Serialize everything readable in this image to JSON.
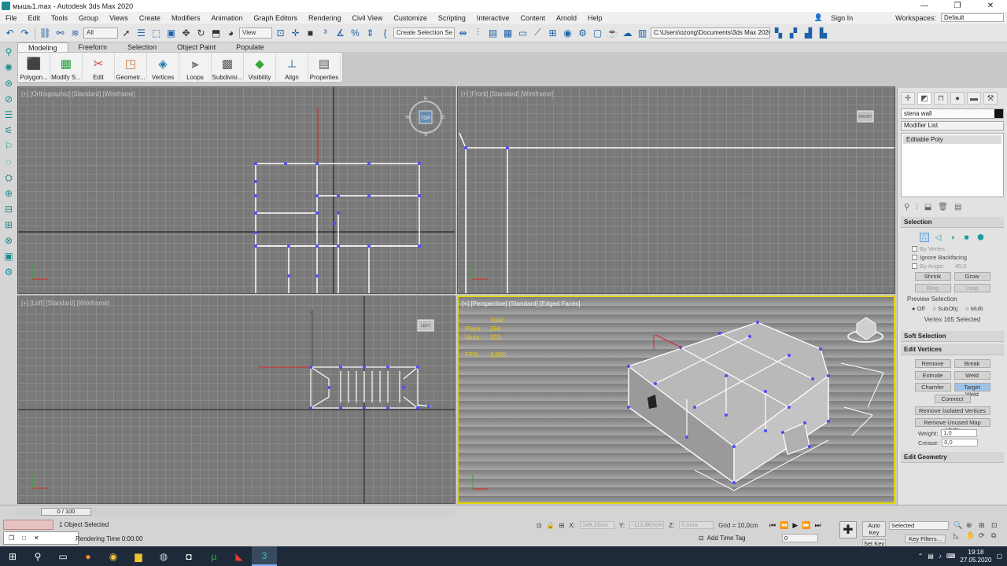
{
  "window": {
    "title": "мышь1.max - Autodesk 3ds Max 2020"
  },
  "menu": [
    "File",
    "Edit",
    "Tools",
    "Group",
    "Views",
    "Create",
    "Modifiers",
    "Animation",
    "Graph Editors",
    "Rendering",
    "Civil View",
    "Customize",
    "Scripting",
    "Interactive",
    "Content",
    "Arnold",
    "Help"
  ],
  "account": {
    "sign_in": "Sign In",
    "workspaces_label": "Workspaces:",
    "workspace": "Default"
  },
  "toolbar": {
    "filter": "All",
    "ref_coord": "View",
    "selection_set": "Create Selection Se",
    "project_path": "C:\\Users\\ozong\\Documents\\3ds Max 2020"
  },
  "ribbon": {
    "tabs": [
      "Modeling",
      "Freeform",
      "Selection",
      "Object Paint",
      "Populate"
    ],
    "buttons": [
      "Polygon...",
      "Modify S...",
      "Edit",
      "Geometr...",
      "Vertices",
      "Loops",
      "Subdivisi...",
      "Visibility",
      "Align",
      "Properties"
    ]
  },
  "viewports": {
    "top": "[+] [Orthographic] [Standard] [Wireframe]",
    "front": "[+] [Front] [Standard] [Wireframe]",
    "left": "[+] [Left] [Standard] [Wireframe]",
    "persp": "[+] [Perspective] [Standard] [Edged Faces]",
    "viewcube_top": "TOP",
    "viewcube_front": "FRONT",
    "viewcube_left": "LEFT",
    "compass": {
      "n": "N",
      "s": "S",
      "w": "W",
      "e": "E"
    },
    "axis": {
      "x": "x",
      "y": "y",
      "z": "z"
    },
    "stats": {
      "total": "Total",
      "polys_label": "Polys:",
      "polys": "264",
      "verts_label": "Verts:",
      "verts": "323",
      "fps_label": "FPS:",
      "fps": "3,880"
    }
  },
  "command_panel": {
    "object_name": "stena wall",
    "modifier_list": "Modifier List",
    "stack_item": "Editable Poly",
    "selection": {
      "title": "Selection",
      "by_vertex": "By Vertex",
      "ignore_backfacing": "Ignore Backfacing",
      "by_angle": "By Angle:",
      "angle_value": "45,0",
      "shrink": "Shrink",
      "grow": "Grow",
      "ring": "Ring",
      "loop": "Loop",
      "preview_selection": "Preview Selection",
      "off": "Off",
      "subobj": "SubObj",
      "multi": "Multi",
      "status": "Vertex 165 Selected"
    },
    "soft_selection": "Soft Selection",
    "edit_vertices": {
      "title": "Edit Vertices",
      "remove": "Remove",
      "break": "Break",
      "extrude": "Extrude",
      "weld": "Weld",
      "chamfer": "Chamfer",
      "target_weld": "Target Weld",
      "connect": "Connect",
      "remove_isolated": "Remove Isolated Vertices",
      "remove_unused": "Remove Unused Map Verts",
      "weight_label": "Weight:",
      "weight": "1,0",
      "crease_label": "Crease:",
      "crease": "0,0"
    },
    "edit_geometry": "Edit Geometry"
  },
  "status": {
    "time_slider": "0 / 100",
    "objects_selected": "1 Object Selected",
    "time": "Rendering Time 0:00:00",
    "x_label": "X:",
    "x": "149,15cm",
    "y_label": "Y:",
    "y": "-112,867cm",
    "z_label": "Z:",
    "z": "0,0cm",
    "grid": "Grid = 10,0cm",
    "add_time_tag": "Add Time Tag",
    "frame": "0",
    "auto_key": "Auto Key",
    "set_key": "Set Key",
    "key_mode": "Selected",
    "key_filters": "Key Filters..."
  },
  "taskbar": {
    "time": "19:18",
    "date": "27.05.2020"
  }
}
